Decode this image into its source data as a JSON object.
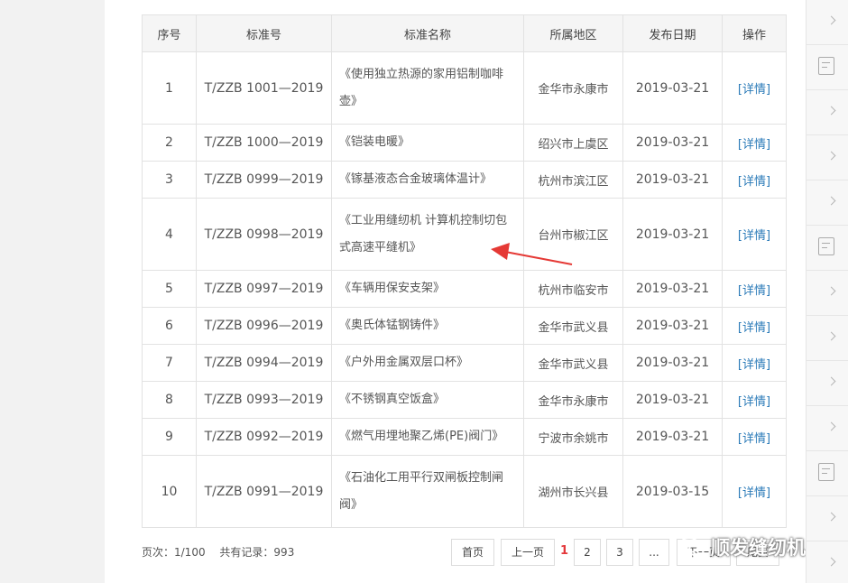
{
  "table": {
    "headers": [
      "序号",
      "标准号",
      "标准名称",
      "所属地区",
      "发布日期",
      "操作"
    ],
    "rows": [
      {
        "no": "1",
        "code": "T/ZZB 1001—2019",
        "name": "《使用独立热源的家用铝制咖啡壶》",
        "region": "金华市永康市",
        "date": "2019-03-21",
        "action": "[详情]"
      },
      {
        "no": "2",
        "code": "T/ZZB 1000—2019",
        "name": "《铠装电暖》",
        "region": "绍兴市上虞区",
        "date": "2019-03-21",
        "action": "[详情]"
      },
      {
        "no": "3",
        "code": "T/ZZB 0999—2019",
        "name": "《镓基液态合金玻璃体温计》",
        "region": "杭州市滨江区",
        "date": "2019-03-21",
        "action": "[详情]"
      },
      {
        "no": "4",
        "code": "T/ZZB 0998—2019",
        "name": "《工业用缝纫机 计算机控制切包式高速平缝机》",
        "region": "台州市椒江区",
        "date": "2019-03-21",
        "action": "[详情]"
      },
      {
        "no": "5",
        "code": "T/ZZB 0997—2019",
        "name": "《车辆用保安支架》",
        "region": "杭州市临安市",
        "date": "2019-03-21",
        "action": "[详情]"
      },
      {
        "no": "6",
        "code": "T/ZZB 0996—2019",
        "name": "《奥氏体锰钢铸件》",
        "region": "金华市武义县",
        "date": "2019-03-21",
        "action": "[详情]"
      },
      {
        "no": "7",
        "code": "T/ZZB 0994—2019",
        "name": "《户外用金属双层口杯》",
        "region": "金华市武义县",
        "date": "2019-03-21",
        "action": "[详情]"
      },
      {
        "no": "8",
        "code": "T/ZZB 0993—2019",
        "name": "《不锈钢真空饭盒》",
        "region": "金华市永康市",
        "date": "2019-03-21",
        "action": "[详情]"
      },
      {
        "no": "9",
        "code": "T/ZZB 0992—2019",
        "name": "《燃气用埋地聚乙烯(PE)阀门》",
        "region": "宁波市余姚市",
        "date": "2019-03-21",
        "action": "[详情]"
      },
      {
        "no": "10",
        "code": "T/ZZB 0991—2019",
        "name": "《石油化工用平行双闸板控制闸阀》",
        "region": "湖州市长兴县",
        "date": "2019-03-15",
        "action": "[详情]"
      }
    ]
  },
  "pager": {
    "page_label": "页次：1/100",
    "total_label": "共有记录：993",
    "first": "首页",
    "prev": "上一页",
    "current": "1",
    "page2": "2",
    "page3": "3",
    "ellipsis": "...",
    "next": "下一页",
    "last": "尾页"
  },
  "watermark": {
    "text": "顺发缝纫机"
  },
  "icons": {
    "rail_chevron": "chevron-right-icon",
    "rail_doc": "document-edit-icon",
    "wechat": "wechat-icon"
  },
  "colors": {
    "link": "#2a7ab8",
    "current_page": "#e4393c",
    "arrow": "#e53935"
  }
}
